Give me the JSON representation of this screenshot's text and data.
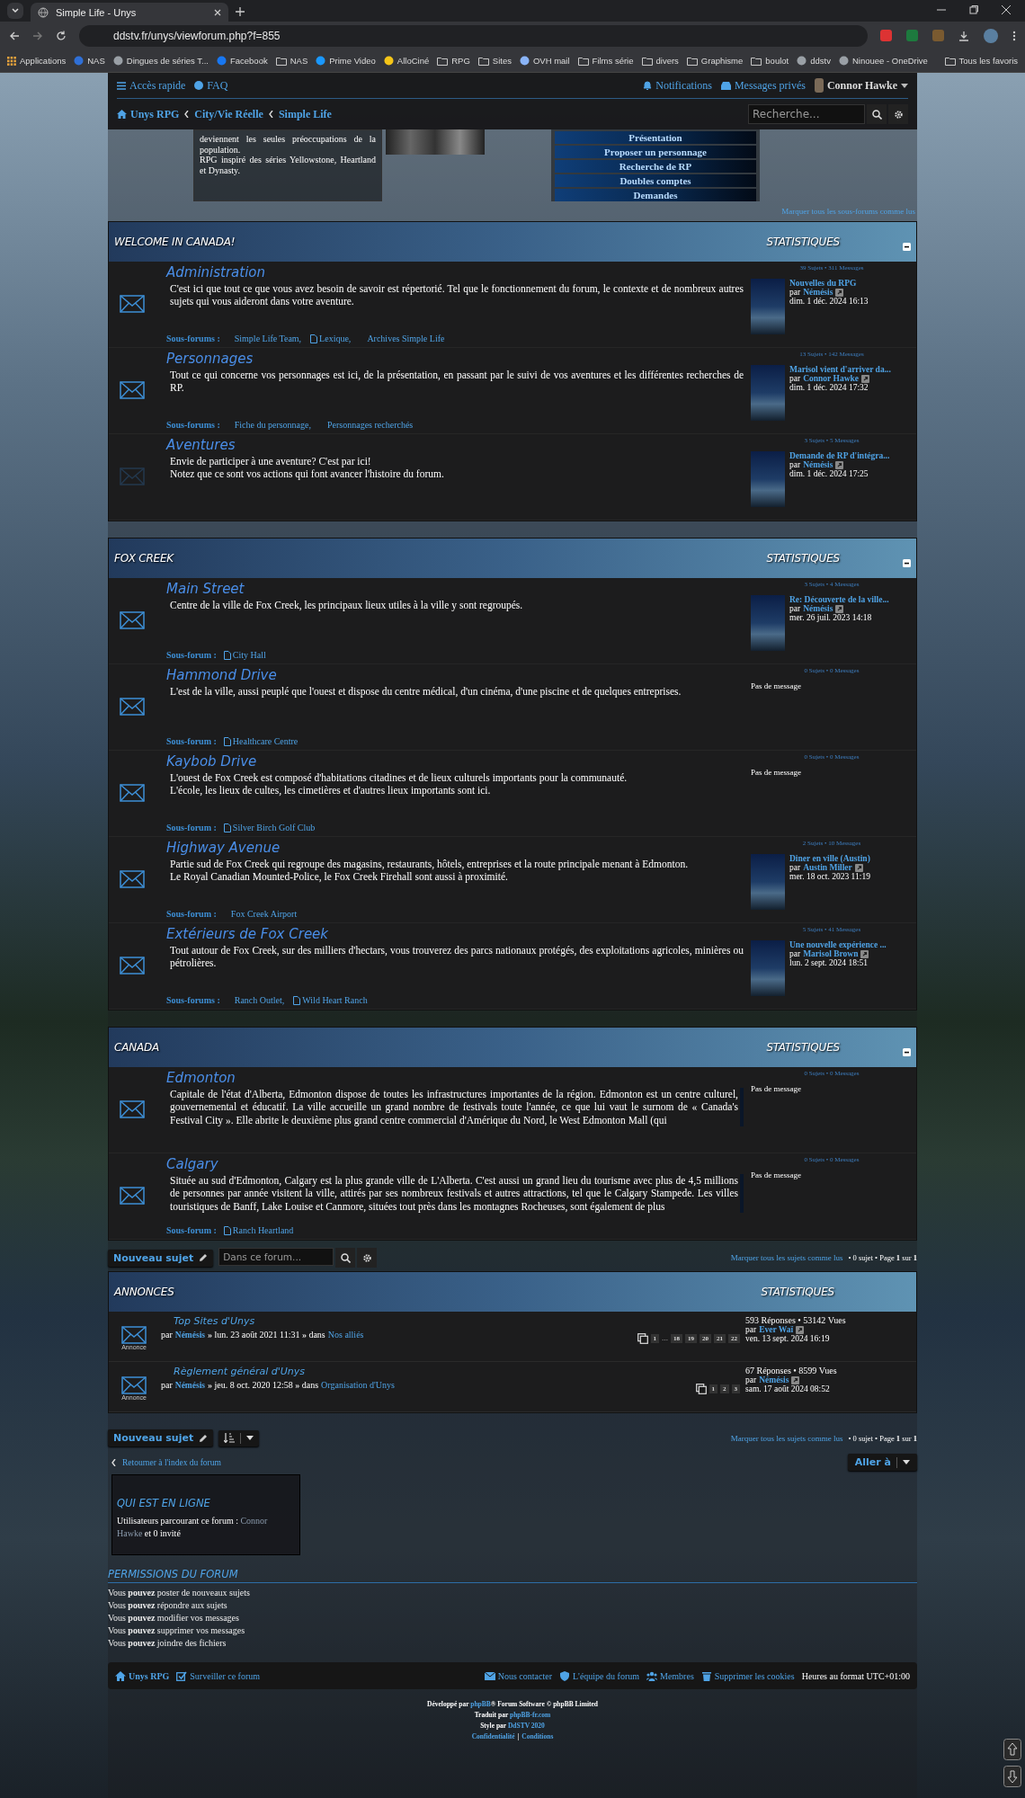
{
  "browser": {
    "tab_title": "Simple Life - Unys",
    "url": "ddstv.fr/unys/viewforum.php?f=855",
    "bookmarks": [
      {
        "label": "Applications",
        "kind": "apps"
      },
      {
        "label": "NAS",
        "kind": "site",
        "color": "#2f6fd6"
      },
      {
        "label": "Dingues de séries T...",
        "kind": "site",
        "color": "#9aa0a6"
      },
      {
        "label": "Facebook",
        "kind": "site",
        "color": "#1877f2"
      },
      {
        "label": "NAS",
        "kind": "folder"
      },
      {
        "label": "Prime Video",
        "kind": "site",
        "color": "#1a98ff"
      },
      {
        "label": "AlloCiné",
        "kind": "site",
        "color": "#f5c518"
      },
      {
        "label": "RPG",
        "kind": "folder"
      },
      {
        "label": "Sites",
        "kind": "folder"
      },
      {
        "label": "OVH mail",
        "kind": "site",
        "color": "#8ab4f8"
      },
      {
        "label": "Films série",
        "kind": "folder"
      },
      {
        "label": "divers",
        "kind": "folder"
      },
      {
        "label": "Graphisme",
        "kind": "folder"
      },
      {
        "label": "boulot",
        "kind": "folder"
      },
      {
        "label": "ddstv",
        "kind": "site",
        "color": "#9aa0a6"
      },
      {
        "label": "Ninouee - OneDrive",
        "kind": "site",
        "color": "#9aa0a6"
      }
    ],
    "all_bookmarks": "Tous les favoris"
  },
  "navbar": {
    "quick_access": "Accès rapide",
    "faq": "FAQ",
    "notifications": "Notifications",
    "private_messages": "Messages privés",
    "user": "Connor Hawke",
    "breadcrumbs": [
      "Unys RPG",
      "City/Vie Réelle",
      "Simple Life"
    ],
    "search": {
      "placeholder": "Recherche..."
    }
  },
  "banner": {
    "text_lines": [
      "deviennent les seules préoccupations de la population.",
      "RPG inspiré des séries Yellowstone, Heartland et Dynasty."
    ],
    "menu": [
      "Présentation",
      "Proposer un personnage",
      "Recherche de RP",
      "Doubles comptes",
      "Demandes"
    ]
  },
  "mark_subforums_read": "Marquer tous les sous-forums comme lus",
  "categories": [
    {
      "title": "WELCOME IN CANADA!",
      "stats_heading": "STATISTIQUES",
      "collapsible": true,
      "forums": [
        {
          "name": "Administration",
          "unread": true,
          "description": "C'est ici que tout ce que vous avez besoin de savoir est répertorié. Tel que le fonctionnement du forum, le contexte et de nombreux autres sujets qui vous aideront dans votre aventure.",
          "scroll": false,
          "subforums_label": "Sous-forums :",
          "subforums": [
            {
              "name": "Simple Life Team",
              "icon": false,
              "sep": ","
            },
            {
              "name": "Lexique",
              "icon": true,
              "sep": ","
            },
            {
              "name": "Archives Simple Life",
              "icon": false
            }
          ],
          "stats": "39 Sujets • 311 Messages",
          "last_post": {
            "title": "Nouvelles du RPG",
            "by": "par",
            "author": "Némésis",
            "date": "dim. 1 déc. 2024 16:13"
          }
        },
        {
          "name": "Personnages",
          "unread": true,
          "description": "Tout ce qui concerne vos personnages est ici, de la présentation, en passant par le suivi de vos aventures et les différentes recherches de RP.",
          "scroll": false,
          "subforums_label": "Sous-forums :",
          "subforums": [
            {
              "name": "Fiche du personnage",
              "icon": false,
              "sep": ","
            },
            {
              "name": "Personnages recherchés",
              "icon": false
            }
          ],
          "stats": "13 Sujets • 142 Messages",
          "last_post": {
            "title": "Marisol vient d'arriver da...",
            "by": "par",
            "author": "Connor Hawke",
            "date": "dim. 1 déc. 2024 17:32"
          }
        },
        {
          "name": "Aventures",
          "unread": false,
          "description": "Envie de participer à une aventure? C'est par ici!\nNotez que ce sont vos actions qui font avancer l'histoire du forum.",
          "scroll": false,
          "stats": "3 Sujets • 5 Messages",
          "last_post": {
            "title": "Demande de RP d'intégra...",
            "by": "par",
            "author": "Némésis",
            "date": "dim. 1 déc. 2024 17:25"
          }
        }
      ]
    },
    {
      "title": "FOX CREEK",
      "stats_heading": "STATISTIQUES",
      "collapsible": true,
      "forums": [
        {
          "name": "Main Street",
          "unread": true,
          "description": "Centre de la ville de Fox Creek, les principaux lieux utiles à la ville y sont regroupés.",
          "scroll": false,
          "subforums_label": "Sous-forum :",
          "subforums": [
            {
              "name": "City Hall",
              "icon": true
            }
          ],
          "stats": "3 Sujets • 4 Messages",
          "last_post": {
            "title": "Re: Découverte de la ville...",
            "by": "par",
            "author": "Némésis",
            "date": "mer. 26 juil. 2023 14:18"
          }
        },
        {
          "name": "Hammond Drive",
          "unread": true,
          "description": "L'est de la ville, aussi peuplé que l'ouest et dispose du centre médical, d'un cinéma, d'une piscine et de quelques entreprises.",
          "scroll": false,
          "subforums_label": "Sous-forum :",
          "subforums": [
            {
              "name": "Healthcare Centre",
              "icon": true
            }
          ],
          "stats": "0 Sujets • 0 Messages",
          "no_post": "Pas de message"
        },
        {
          "name": "Kaybob Drive",
          "unread": true,
          "description": "L'ouest de Fox Creek est composé d'habitations citadines et de lieux culturels importants pour la communauté.\nL'école, les lieux de cultes, les cimetières et d'autres lieux importants sont ici.",
          "scroll": false,
          "subforums_label": "Sous-forum :",
          "subforums": [
            {
              "name": "Silver Birch Golf Club",
              "icon": true
            }
          ],
          "stats": "0 Sujets • 0 Messages",
          "no_post": "Pas de message"
        },
        {
          "name": "Highway Avenue",
          "unread": true,
          "description": "Partie sud de Fox Creek qui regroupe des magasins, restaurants, hôtels, entreprises et la route principale menant à Edmonton.\nLe Royal Canadian Mounted-Police, le Fox Creek Firehall sont aussi à proximité.",
          "scroll": false,
          "subforums_label": "Sous-forum :",
          "subforums": [
            {
              "name": "Fox Creek Airport",
              "icon": false
            }
          ],
          "stats": "2 Sujets • 10 Messages",
          "last_post": {
            "title": "Diner en ville (Austin)",
            "by": "par",
            "author": "Austin Miller",
            "date": "mer. 18 oct. 2023 11:19"
          }
        },
        {
          "name": "Extérieurs de Fox Creek",
          "unread": true,
          "description": "Tout autour de Fox Creek, sur des milliers d'hectars, vous trouverez des parcs nationaux protégés, des exploitations agricoles, minières ou pétrolières.",
          "scroll": false,
          "subforums_label": "Sous-forums :",
          "subforums": [
            {
              "name": "Ranch Outlet",
              "icon": false,
              "sep": ","
            },
            {
              "name": "Wild Heart Ranch",
              "icon": true
            }
          ],
          "stats": "5 Sujets • 41 Messages",
          "last_post": {
            "title": "Une nouvelle expérience ...",
            "by": "par",
            "author": "Marisol Brown",
            "date": "lun. 2 sept. 2024 18:51"
          }
        }
      ]
    },
    {
      "title": "CANADA",
      "stats_heading": "STATISTIQUES",
      "collapsible": true,
      "forums": [
        {
          "name": "Edmonton",
          "unread": true,
          "description": "Capitale de l'état d'Alberta, Edmonton dispose de toutes les infrastructures importantes de la région. Edmonton est un centre culturel, gouvernemental et éducatif. La ville accueille un grand nombre de festivals toute l'année, ce que lui vaut le surnom de « Canada's Festival City ». Elle abrite le deuxième plus grand centre commercial d'Amérique du Nord, le West Edmonton Mall (qui",
          "scroll": true,
          "stats": "0 Sujets • 0 Messages",
          "no_post": "Pas de message"
        },
        {
          "name": "Calgary",
          "unread": true,
          "description": "Située au sud d'Edmonton, Calgary est la plus grande ville de L'Alberta. C'est aussi un grand lieu du tourisme avec plus de 4,5 millions de personnes par année visitent la ville, attirés par ses nombreux festivals et autres attractions, tel que le Calgary Stampede. Les villes touristiques de Banff, Lake Louise et Canmore, situées tout près dans les montagnes Rocheuses, sont également de plus",
          "scroll": true,
          "subforums_label": "Sous-forum :",
          "subforums": [
            {
              "name": "Ranch Heartland",
              "icon": true
            }
          ],
          "stats": "0 Sujets • 0 Messages",
          "no_post": "Pas de message"
        }
      ]
    }
  ],
  "action_bar_top": {
    "new_topic": "Nouveau sujet",
    "search": {
      "placeholder": "Dans ce forum..."
    },
    "mark_topics_read": "Marquer tous les sujets comme lus",
    "summary": "• 0 sujet • Page **1** sur **1**"
  },
  "announcements": {
    "title": "ANNONCES",
    "stats_heading": "STATISTIQUES",
    "topics": [
      {
        "title": "Top Sites d'Unys",
        "icon_label": "Annonce",
        "by": "par",
        "author": "Némésis",
        "meta": "» lun. 23 août 2021 11:31 » dans",
        "forum": "Nos alliés",
        "pages": [
          "1",
          "…",
          "18",
          "19",
          "20",
          "21",
          "22"
        ],
        "stats": "593 Réponses • 53142 Vues",
        "last_by": "par",
        "last_author": "Ever Waï",
        "last_date": "ven. 13 sept. 2024 16:19"
      },
      {
        "title": "Règlement général d'Unys",
        "icon_label": "Annonce",
        "by": "par",
        "author": "Némésis",
        "meta": "» jeu. 8 oct. 2020 12:58 » dans",
        "forum": "Organisation d'Unys",
        "pages": [
          "1",
          "2",
          "3"
        ],
        "stats": "67 Réponses • 8599 Vues",
        "last_by": "par",
        "last_author": "Némésis",
        "last_date": "sam. 17 août 2024 08:52"
      }
    ]
  },
  "action_bar_bottom": {
    "new_topic": "Nouveau sujet",
    "mark_topics_read": "Marquer tous les sujets comme lus",
    "summary": "• 0 sujet • Page **1** sur **1**"
  },
  "back_link": "Retourner à l'index du forum",
  "jump_to": "Aller à",
  "online": {
    "title": "QUI EST EN LIGNE",
    "text": "Utilisateurs parcourant ce forum :",
    "user": "Connor Hawke",
    "rest": "et 0 invité"
  },
  "permissions": {
    "title": "PERMISSIONS DU FORUM",
    "lines": [
      "Vous **pouvez** poster de nouveaux sujets",
      "Vous **pouvez** répondre aux sujets",
      "Vous **pouvez** modifier vos messages",
      "Vous **pouvez** supprimer vos messages",
      "Vous **pouvez** joindre des fichiers"
    ]
  },
  "footer_nav": {
    "left": [
      "Unys RPG",
      "Surveiller ce forum"
    ],
    "right": [
      "Nous contacter",
      "L'équipe du forum",
      "Membres",
      "Supprimer les cookies"
    ],
    "timezone": "Heures au format UTC+01:00"
  },
  "credits": [
    {
      "before": "Développé par",
      "link": "phpBB",
      "after": "® Forum Software © phpBB Limited"
    },
    {
      "before": "Traduit par",
      "link": "phpBB-fr.com"
    },
    {
      "before": "Style par",
      "link": "DdSTV 2020"
    }
  ],
  "legal": [
    "Confidentialité",
    "Conditions"
  ],
  "legal_separator": "|"
}
